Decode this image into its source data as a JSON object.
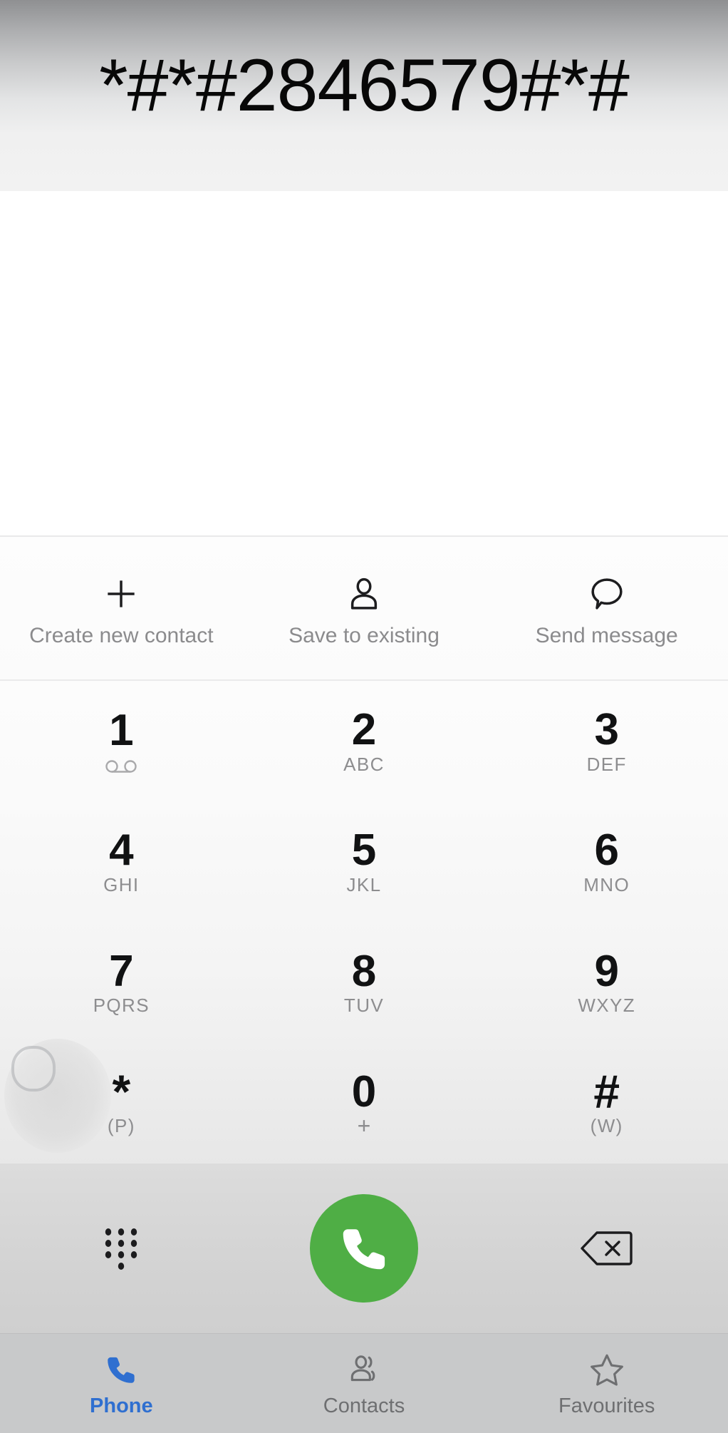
{
  "dialer": {
    "entered_number": "*#*#2846579#*#"
  },
  "contact_actions": [
    {
      "id": "create-new-contact",
      "label": "Create new contact",
      "icon": "plus-icon"
    },
    {
      "id": "save-to-existing",
      "label": "Save to existing",
      "icon": "person-icon"
    },
    {
      "id": "send-message",
      "label": "Send message",
      "icon": "message-bubble-icon"
    }
  ],
  "keypad": {
    "rows": [
      [
        {
          "digit": "1",
          "sub": "",
          "icon": "voicemail-icon"
        },
        {
          "digit": "2",
          "sub": "ABC",
          "icon": ""
        },
        {
          "digit": "3",
          "sub": "DEF",
          "icon": ""
        }
      ],
      [
        {
          "digit": "4",
          "sub": "GHI",
          "icon": ""
        },
        {
          "digit": "5",
          "sub": "JKL",
          "icon": ""
        },
        {
          "digit": "6",
          "sub": "MNO",
          "icon": ""
        }
      ],
      [
        {
          "digit": "7",
          "sub": "PQRS",
          "icon": ""
        },
        {
          "digit": "8",
          "sub": "TUV",
          "icon": ""
        },
        {
          "digit": "9",
          "sub": "WXYZ",
          "icon": ""
        }
      ],
      [
        {
          "digit": "*",
          "sub": "(P)",
          "icon": ""
        },
        {
          "digit": "0",
          "sub": "+",
          "icon": ""
        },
        {
          "digit": "#",
          "sub": "(W)",
          "icon": ""
        }
      ]
    ]
  },
  "dial_row": {
    "keypad_toggle": {
      "id": "keypad-toggle",
      "icon": "keypad-dots-icon"
    },
    "call": {
      "id": "call-button",
      "icon": "phone-handset-icon",
      "color": "#4fae45"
    },
    "backspace": {
      "id": "backspace-button",
      "icon": "backspace-icon"
    }
  },
  "bottom_nav": {
    "active_color": "#2f6fd0",
    "inactive_color": "#6e6f71",
    "tabs": [
      {
        "id": "tab-phone",
        "label": "Phone",
        "icon": "phone-handset-icon",
        "active": true
      },
      {
        "id": "tab-contacts",
        "label": "Contacts",
        "icon": "contacts-icon",
        "active": false
      },
      {
        "id": "tab-favourites",
        "label": "Favourites",
        "icon": "star-outline-icon",
        "active": false
      }
    ]
  }
}
